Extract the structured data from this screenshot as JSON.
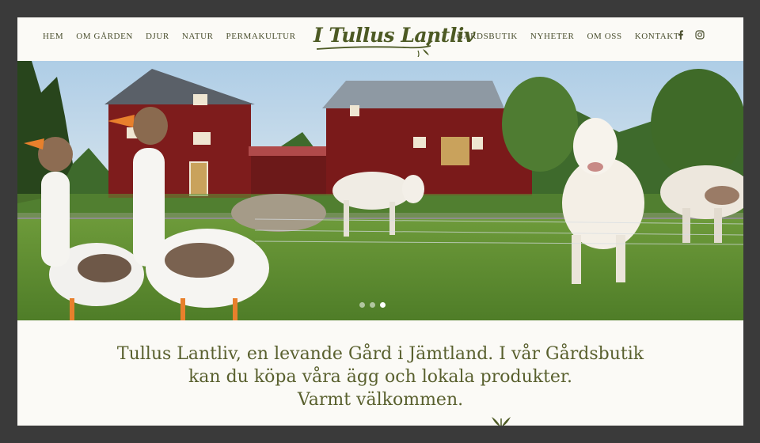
{
  "site": {
    "logo_text": "I Tullus Lantliv"
  },
  "nav_left": [
    {
      "label": "HEM"
    },
    {
      "label": "OM GÅRDEN"
    },
    {
      "label": "DJUR"
    },
    {
      "label": "NATUR"
    },
    {
      "label": "PERMAKULTUR"
    }
  ],
  "nav_right": [
    {
      "label": "GÅRDSBUTIK"
    },
    {
      "label": "NYHETER"
    },
    {
      "label": "OM OSS"
    },
    {
      "label": "KONTAKT"
    }
  ],
  "social": [
    {
      "icon": "facebook-icon"
    },
    {
      "icon": "instagram-icon"
    }
  ],
  "hero": {
    "slides_count": 3,
    "active_slide": 3
  },
  "tagline": {
    "line1": "Tullus Lantliv, en levande Gård i Jämtland. I vår Gårdsbutik",
    "line2": "kan du köpa våra ägg och lokala produkter.",
    "line3": "Varmt välkommen."
  },
  "colors": {
    "brand": "#4d5a24",
    "text": "#59602e",
    "background": "#fbfaf6",
    "frame": "#3a3a3a"
  }
}
